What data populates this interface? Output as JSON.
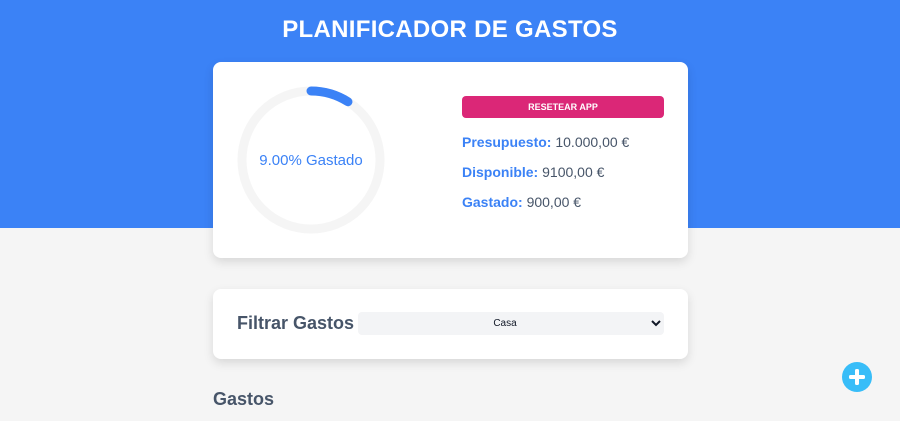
{
  "header": {
    "title": "PLANIFICADOR DE GASTOS"
  },
  "budget": {
    "progress_percent": 9,
    "progress_label": "9.00% Gastado",
    "reset_label": "Resetear App",
    "presupuesto": {
      "label": "Presupuesto:",
      "value": "10.000,00 €"
    },
    "disponible": {
      "label": "Disponible:",
      "value": "9100,00 €"
    },
    "gastado": {
      "label": "Gastado:",
      "value": "900,00 €"
    }
  },
  "filter": {
    "label": "Filtrar Gastos",
    "selected": "Casa"
  },
  "expenses": {
    "title": "Gastos"
  },
  "icons": {
    "add": "plus-icon"
  },
  "colors": {
    "primary": "#3b82f6",
    "reset": "#db2777",
    "add_button": "#38bdf8",
    "track": "#f5f5f5"
  }
}
